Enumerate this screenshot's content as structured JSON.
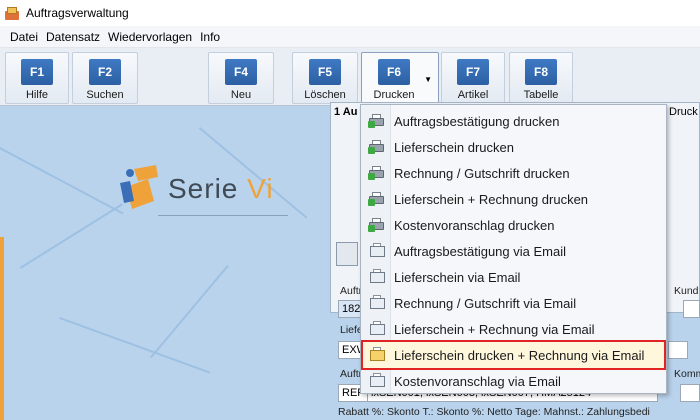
{
  "window": {
    "title": "Auftragsverwaltung"
  },
  "menubar": {
    "items": [
      {
        "label": "Datei"
      },
      {
        "label": "Datensatz"
      },
      {
        "label": "Wiedervorlagen"
      },
      {
        "label": "Info"
      }
    ]
  },
  "toolbar": {
    "buttons": [
      {
        "key": "F1",
        "label": "Hilfe"
      },
      {
        "key": "F2",
        "label": "Suchen"
      },
      {
        "key": "F4",
        "label": "Neu"
      },
      {
        "key": "F5",
        "label": "Löschen"
      },
      {
        "key": "F6",
        "label": "Drucken"
      },
      {
        "key": "F7",
        "label": "Artikel"
      },
      {
        "key": "F8",
        "label": "Tabelle"
      }
    ]
  },
  "logo": {
    "text_main": "Serie ",
    "text_accent": "Vi"
  },
  "form": {
    "tab_label": "1 Au",
    "tab_right": "Druck",
    "label_auftr": "Auftr",
    "value_auftr": "182",
    "label_kunde": "Kund",
    "label_liefer": "Liefe",
    "value_liefer": "EXW",
    "label_auftr2": "Auftr",
    "label_komm": "Komm",
    "value_ref": "REF",
    "value_ref_tail": "ixSEN001, ixSEN003, ixSEN007, HMA25124",
    "footer": "Rabatt %:  Skonto T.:   Skonto %:   Netto Tage:   Mahnst.:  Zahlungsbedi"
  },
  "dropdown": {
    "items": [
      {
        "label": "Auftragsbestätigung drucken",
        "icon": "printer-icon"
      },
      {
        "label": "Lieferschein drucken",
        "icon": "printer-icon"
      },
      {
        "label": "Rechnung / Gutschrift drucken",
        "icon": "printer-icon"
      },
      {
        "label": "Lieferschein + Rechnung drucken",
        "icon": "printer-icon"
      },
      {
        "label": "Kostenvoranschlag drucken",
        "icon": "printer-icon"
      },
      {
        "label": "Auftragsbestätigung via Email",
        "icon": "mail-icon"
      },
      {
        "label": "Lieferschein via Email",
        "icon": "mail-icon"
      },
      {
        "label": "Rechnung / Gutschrift via Email",
        "icon": "mail-icon"
      },
      {
        "label": "Lieferschein + Rechnung via Email",
        "icon": "mail-icon"
      },
      {
        "label": "Lieferschein drucken + Rechnung via Email",
        "icon": "print-mail-icon"
      },
      {
        "label": "Kostenvoranschlag via Email",
        "icon": "mail-icon"
      }
    ]
  },
  "colors": {
    "accent": "#f0a23a",
    "highlight_border": "#e02424",
    "background": "#b9d3ec"
  }
}
